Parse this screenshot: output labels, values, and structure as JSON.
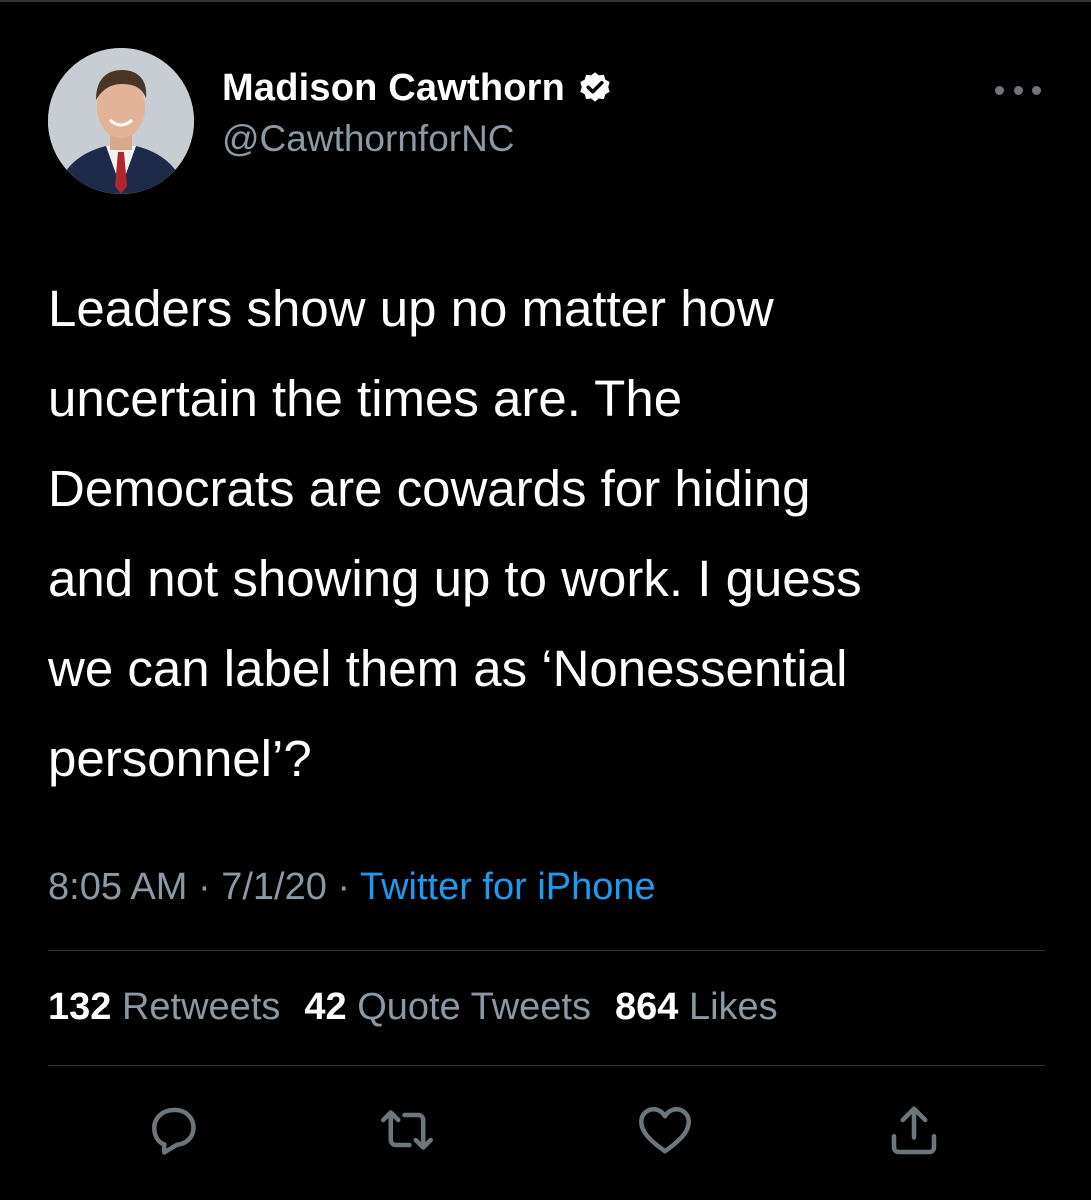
{
  "tweet": {
    "author": {
      "display_name": "Madison Cawthorn",
      "handle": "@CawthornforNC",
      "verified": true
    },
    "text": "Leaders show up no matter how\nuncertain the times are. The\nDemocrats are cowards for hiding\nand not showing up to work. I guess\nwe can label them as ‘Nonessential\npersonnel’?",
    "time": "8:05 AM",
    "separator": " · ",
    "date": "7/1/20",
    "source": "Twitter for iPhone",
    "stats": {
      "retweets_count": "132",
      "retweets_label": "Retweets",
      "quotes_count": "42",
      "quotes_label": "Quote Tweets",
      "likes_count": "864",
      "likes_label": "Likes"
    },
    "actions": [
      {
        "name": "reply",
        "icon": "reply-icon"
      },
      {
        "name": "retweet",
        "icon": "retweet-icon"
      },
      {
        "name": "like",
        "icon": "heart-icon"
      },
      {
        "name": "share",
        "icon": "share-icon"
      }
    ]
  },
  "colors": {
    "background": "#000000",
    "text_primary": "#ffffff",
    "text_secondary": "#8b98a5",
    "link": "#1d9bf0",
    "divider": "#2f3336",
    "icon": "#6e767d"
  }
}
